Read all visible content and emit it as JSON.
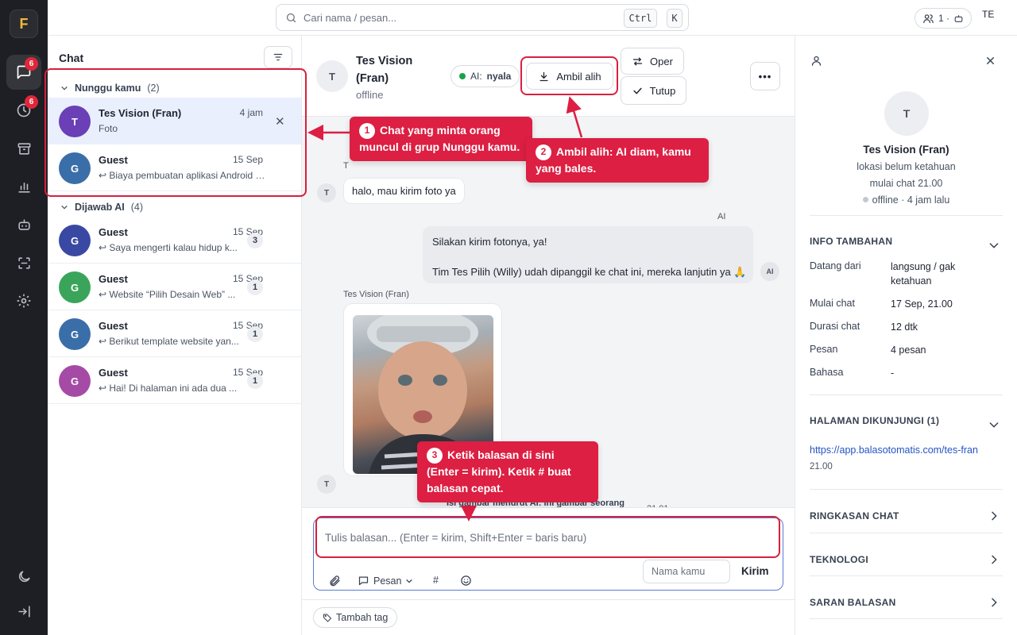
{
  "app": {
    "logo_letter": "F"
  },
  "rail": {
    "chat_badge": "6",
    "history_badge": "6"
  },
  "topbar": {
    "search_placeholder": "Cari nama / pesan...",
    "kbd_ctrl": "Ctrl",
    "kbd_k": "K",
    "agents_count": "1 ·",
    "user_initials": "TE"
  },
  "list": {
    "title": "Chat",
    "groups": [
      {
        "label": "Nunggu kamu",
        "count": "(2)"
      },
      {
        "label": "Dijawab AI",
        "count": "(4)"
      }
    ],
    "items": [
      {
        "initial": "T",
        "name": "Tes Vision (Fran)",
        "time": "4 jam",
        "preview": "Foto",
        "color": "#6b3fb5"
      },
      {
        "initial": "G",
        "name": "Guest",
        "time": "15 Sep",
        "preview": "↩ Biaya pembuatan aplikasi Android …",
        "color": "#3a6ea8"
      },
      {
        "initial": "G",
        "name": "Guest",
        "time": "15 Sep",
        "preview": "↩ Saya mengerti kalau hidup k...",
        "unread": "3",
        "color": "#3949a3"
      },
      {
        "initial": "G",
        "name": "Guest",
        "time": "15 Sep",
        "preview": "↩ Website “Pilih Desain Web” ...",
        "unread": "1",
        "color": "#3aa55a"
      },
      {
        "initial": "G",
        "name": "Guest",
        "time": "15 Sep",
        "preview": "↩ Berikut template website yan...",
        "unread": "1",
        "color": "#3a6ea8"
      },
      {
        "initial": "G",
        "name": "Guest",
        "time": "15 Sep",
        "preview": "↩ Hai! Di halaman ini ada dua ...",
        "unread": "1",
        "color": "#a54ba5"
      }
    ]
  },
  "conv": {
    "avatar_initial": "T",
    "name": "Tes Vision (Fran)",
    "status": "offline",
    "ai_label": "AI:",
    "ai_state": "nyala",
    "takeover_label": "Ambil alih",
    "transfer_label": "Oper",
    "close_label": "Tutup",
    "more_label": "•••",
    "messages": {
      "sender_cut": "T",
      "user_initial": "T",
      "msg1": "halo, mau kirim foto ya",
      "ai_sender": "AI",
      "ai_line1": "Silakan kirim fotonya, ya!",
      "ai_line2": "Tim Tes Pilih (Willy) udah dipanggil ke chat ini, mereka lanjutin ya 🙏",
      "ai_avatar": "AI",
      "photo_sender": "Tes Vision (Fran)",
      "photo_avatar": "T",
      "peek_text": "Isi gambar menurut AI: ini gambar seorang",
      "peek_time": "21.01"
    },
    "composer": {
      "placeholder": "Tulis balasan... (Enter = kirim, Shift+Enter = baris baru)",
      "msg_menu": "Pesan",
      "hash": "#",
      "name_placeholder": "Nama kamu",
      "send": "Kirim"
    },
    "tag_button": "Tambah tag"
  },
  "rpanel": {
    "avatar_initial": "T",
    "name": "Tes Vision (Fran)",
    "location": "lokasi belum ketahuan",
    "started": "mulai chat 21.00",
    "presence": "offline · 4 jam lalu",
    "info_title": "INFO TAMBAHAN",
    "info": [
      {
        "k": "Datang dari",
        "v": "langsung / gak ketahuan"
      },
      {
        "k": "Mulai chat",
        "v": "17 Sep, 21.00"
      },
      {
        "k": "Durasi chat",
        "v": "12 dtk"
      },
      {
        "k": "Pesan",
        "v": "4 pesan"
      },
      {
        "k": "Bahasa",
        "v": "-"
      }
    ],
    "pages_title": "HALAMAN DIKUNJUNGI (1)",
    "page_url": "https://app.balasotomatis.com/tes-fran",
    "page_time": "21.00",
    "summary_title": "RINGKASAN CHAT",
    "tech_title": "TEKNOLOGI",
    "suggest_title": "SARAN BALASAN"
  },
  "annotations": {
    "c1_num": "1",
    "c1_text": "Chat yang minta orang muncul di grup Nunggu kamu.",
    "c2_num": "2",
    "c2_bold": "Ambil alih",
    "c2_text": ": AI diam, kamu yang bales.",
    "c3_num": "3",
    "c3_text": "Ketik balasan di sini (Enter = kirim). Ketik # buat balasan cepat."
  },
  "colors": {
    "accent_red": "#dc1f42",
    "rail_bg": "#1d1f24",
    "online_green": "#16a34a",
    "link_blue": "#2454c4"
  }
}
